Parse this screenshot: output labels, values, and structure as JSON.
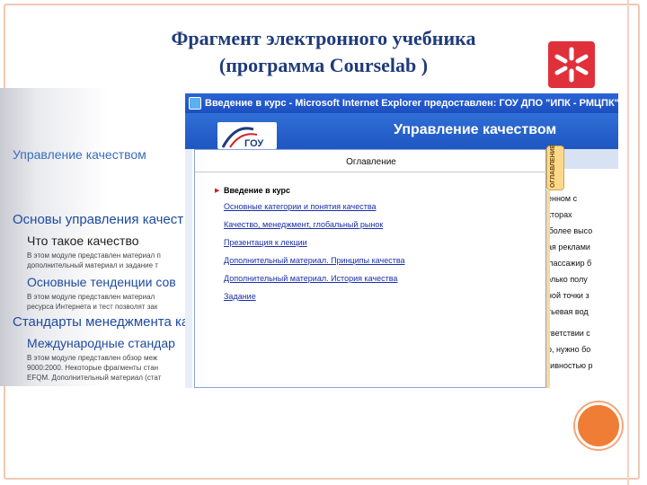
{
  "slide": {
    "title_line1": "Фрагмент электронного учебника",
    "title_line2": "(программа Courselab )"
  },
  "background_page": {
    "heading": "Управление качеством",
    "items": [
      "Основы управления качест",
      "Что такое качество",
      "Основные тенденции сов",
      "Стандарты менеджмента ка",
      "Международные стандар"
    ],
    "small_texts": [
      "В этом модуле представлен материал п",
      "дополнительный материал и задание т",
      "В этом модуле представлен материал",
      "ресурса Интернета и тест позволят зак",
      "В этом модуле представлен обзор меж",
      "9000:2000. Некоторые фрагменты стан",
      "EFQM. Дополнительный материал (стат"
    ]
  },
  "browser": {
    "title": "Введение в курс - Microsoft Internet Explorer предоставлен: ГОУ ДПО \"ИПК - РМЦПК\"",
    "header_title": "Управление качеством",
    "toc_heading": "Оглавление",
    "side_tab_label": "ОГЛАВЛЕНИЕ",
    "toc_items": [
      {
        "label": "Введение в курс",
        "current": true
      },
      {
        "label": "Основные категории и понятия качества",
        "current": false
      },
      {
        "label": "Качество, менеджмент, глобальный рынок",
        "current": false
      },
      {
        "label": "Презентация к лекции",
        "current": false
      },
      {
        "label": "Дополнительный материал. Принципы качества",
        "current": false
      },
      {
        "label": "Дополнительный материал. История качества",
        "current": false
      },
      {
        "label": "Задание",
        "current": false
      }
    ],
    "right_fragments": [
      "ненном с",
      "екторах",
      "т более высо",
      "рая реклами",
      "т пассажир б",
      "только полу",
      "нной точки з",
      "итьевая вод",
      "ответствии с",
      "ер, нужно бо",
      "ктивностью р"
    ]
  },
  "colors": {
    "title": "#1f3b7a",
    "ie_blue": "#2a64d6",
    "logo_red": "#e0303a",
    "accent_orange": "#f07d35"
  },
  "icons": [
    "courselab-logo-icon",
    "ie-window-icon",
    "toc-current-arrow-icon"
  ]
}
